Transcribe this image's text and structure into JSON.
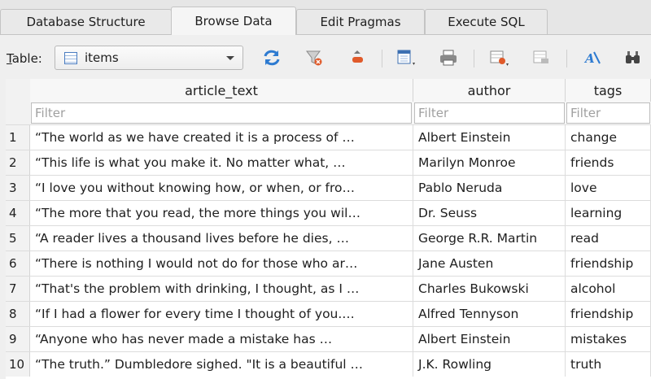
{
  "tabs": [
    {
      "label": "Database Structure"
    },
    {
      "label": "Browse Data"
    },
    {
      "label": "Edit Pragmas"
    },
    {
      "label": "Execute SQL"
    }
  ],
  "toolbar": {
    "table_label_prefix": "T",
    "table_label_rest": "able:",
    "table_selected": "items",
    "icons": [
      "refresh-icon",
      "clear-filters-icon",
      "sort-icon",
      "save-table-icon",
      "print-icon",
      "insert-record-icon",
      "delete-record-icon",
      "find-icon",
      "find-replace-icon"
    ]
  },
  "grid": {
    "columns": [
      "article_text",
      "author",
      "tags"
    ],
    "filter_placeholder": "Filter",
    "rows": [
      {
        "num": "1",
        "text": "“The world as we have created it is a process of …",
        "author": "Albert Einstein",
        "tag": "change"
      },
      {
        "num": "2",
        "text": "“This life is what you make it. No matter what, …",
        "author": "Marilyn Monroe",
        "tag": "friends"
      },
      {
        "num": "3",
        "text": "“I love you without knowing how, or when, or fro…",
        "author": "Pablo Neruda",
        "tag": "love"
      },
      {
        "num": "4",
        "text": "“The more that you read, the more things you wil…",
        "author": "Dr. Seuss",
        "tag": "learning"
      },
      {
        "num": "5",
        "text": "“A reader lives a thousand lives before he dies, …",
        "author": "George R.R. Martin",
        "tag": "read"
      },
      {
        "num": "6",
        "text": "“There is nothing I would not do for those who ar…",
        "author": "Jane Austen",
        "tag": "friendship"
      },
      {
        "num": "7",
        "text": "“That's the problem with drinking, I thought, as I …",
        "author": "Charles Bukowski",
        "tag": "alcohol"
      },
      {
        "num": "8",
        "text": "“If I had a flower for every time I thought of you.…",
        "author": "Alfred Tennyson",
        "tag": "friendship"
      },
      {
        "num": "9",
        "text": "“Anyone who has never made a mistake has …",
        "author": "Albert Einstein",
        "tag": "mistakes"
      },
      {
        "num": "10",
        "text": "“The truth.” Dumbledore sighed. \"It is a beautiful …",
        "author": "J.K. Rowling",
        "tag": "truth"
      }
    ]
  }
}
